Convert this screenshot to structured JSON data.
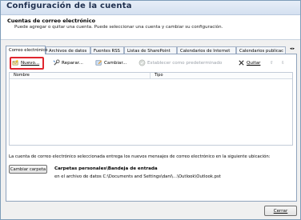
{
  "window": {
    "title": "Configuración de la cuenta"
  },
  "header": {
    "heading": "Cuentas de correo electrónico",
    "description": "Puede agregar o quitar una cuenta. Puede seleccionar una cuenta y cambiar su configuración."
  },
  "tabs": [
    {
      "label": "Correo electrónico",
      "active": true
    },
    {
      "label": "Archivos de datos"
    },
    {
      "label": "Fuentes RSS"
    },
    {
      "label": "Listas de SharePoint"
    },
    {
      "label": "Calendarios de Internet"
    },
    {
      "label": "Calendarios publicac"
    }
  ],
  "tab_scroll": {
    "left": "◂",
    "right": "▸"
  },
  "toolbar": {
    "new_label": "Nuevo...",
    "repair_label": "Reparar...",
    "change_label": "Cambiar...",
    "default_label": "Establecer como predeterminado",
    "remove_label": "Quitar",
    "up_arrow": "⇧",
    "down_arrow": "⇩"
  },
  "accounts_list": {
    "columns": [
      "Nombre",
      "Tipo"
    ],
    "rows": []
  },
  "delivery": {
    "info": "La cuenta de correo electrónico seleccionada entrega los nuevos mensajes de correo electrónico en la siguiente ubicación:",
    "change_folder_label": "Cambiar carpeta",
    "folder_name": "Carpetas personales\\Bandeja de entrada",
    "folder_path": "en el archivo de datos C:\\Documents and Settings\\dani\\...\\Outlook\\Outlook.pst"
  },
  "footer": {
    "close_label": "Cerrar"
  },
  "colors": {
    "highlight": "#e0262f",
    "title_text": "#1e2f4e"
  },
  "icons": {
    "new": "new-account-icon",
    "repair": "repair-icon",
    "change": "change-icon",
    "default": "check-circle-icon",
    "remove": "remove-x-icon"
  }
}
